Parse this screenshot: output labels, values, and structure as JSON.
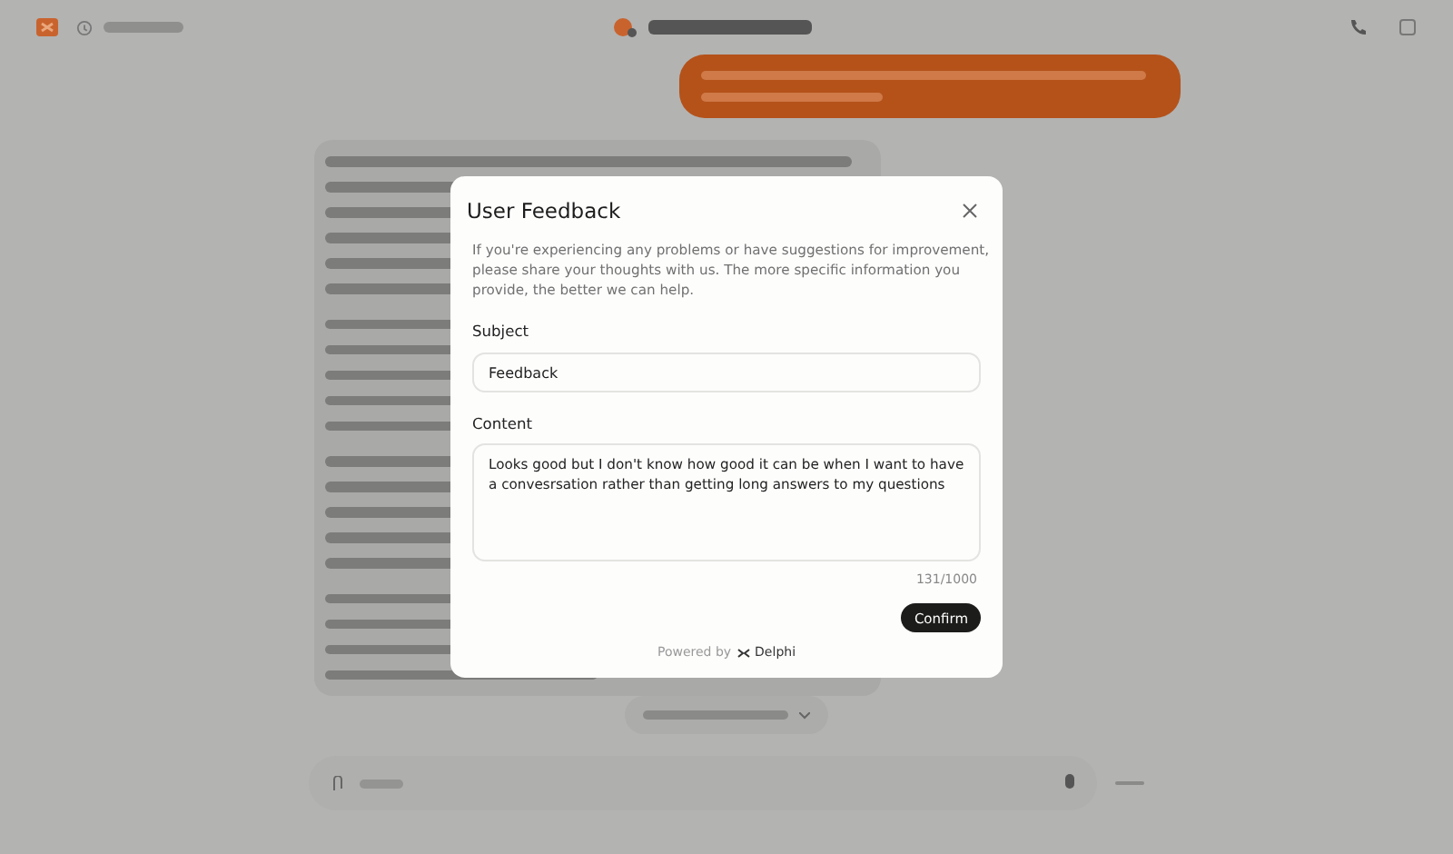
{
  "dialog": {
    "title": "User Feedback",
    "intro": "If you're experiencing any problems or have suggestions for improvement, please share your thoughts with us. The more specific information you provide, the better we can help.",
    "subject": {
      "label": "Subject",
      "value": "Feedback"
    },
    "content": {
      "label": "Content",
      "value": "Looks good but I don't know how good it can be when I want to have a convesrsation rather than getting long answers to my questions",
      "counter": "131/1000"
    },
    "confirm": "Confirm",
    "powered_by": "Powered by",
    "brand": "Delphi"
  }
}
